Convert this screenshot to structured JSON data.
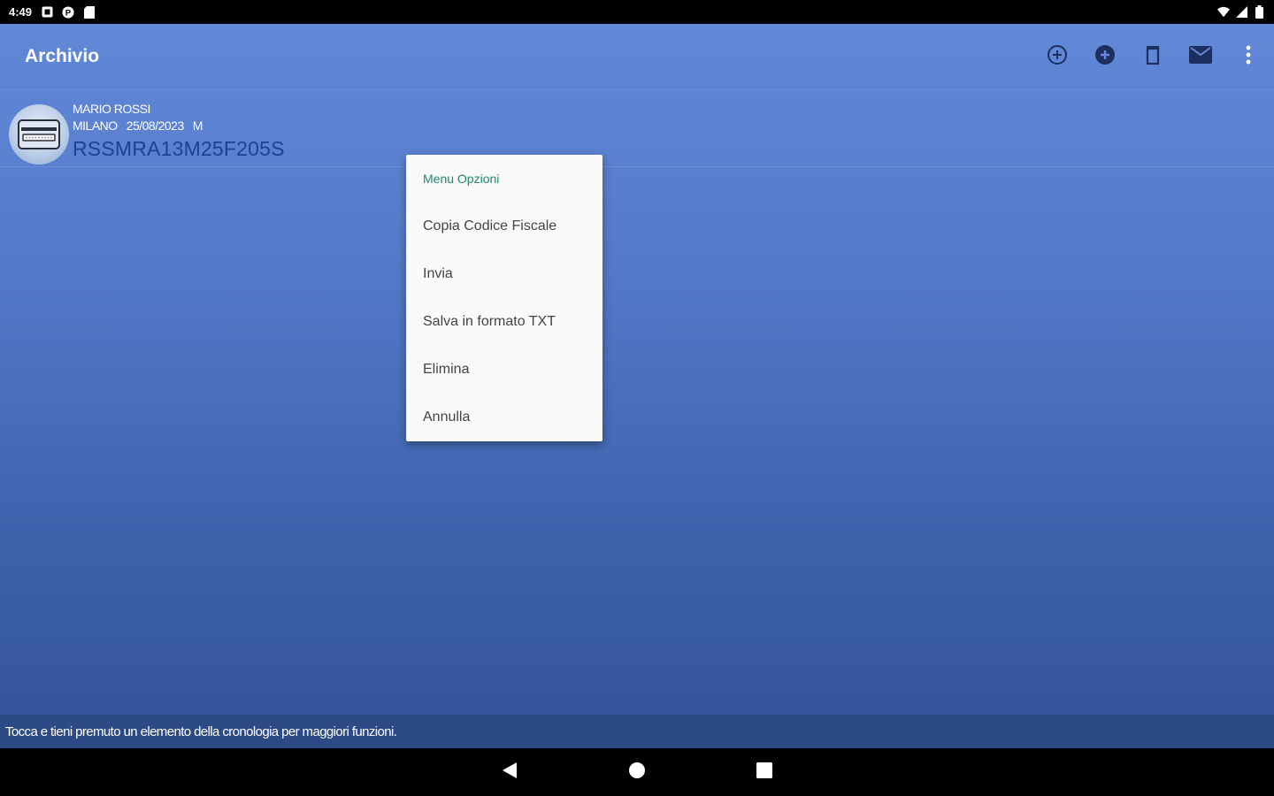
{
  "status_bar": {
    "time": "4:49",
    "left_icons": [
      "notification-square-icon",
      "p-circle-icon",
      "sd-card-icon"
    ],
    "right_icons": [
      "wifi-icon",
      "signal-icon",
      "battery-icon"
    ]
  },
  "toolbar": {
    "title": "Archivio",
    "actions": [
      "add-outline-icon",
      "add-filled-icon",
      "delete-icon",
      "mail-icon",
      "overflow-menu-icon"
    ]
  },
  "history": {
    "items": [
      {
        "name": "MARIO ROSSI",
        "place": "MILANO",
        "date": "25/08/2023",
        "sex": "M",
        "code": "RSSMRA13M25F205S",
        "icon": "id-card-icon"
      }
    ]
  },
  "context_menu": {
    "title": "Menu Opzioni",
    "items": [
      "Copia Codice Fiscale",
      "Invia",
      "Salva in formato TXT",
      "Elimina",
      "Annulla"
    ]
  },
  "hint": {
    "text": "Tocca e tieni premuto un elemento della cronologia per maggiori funzioni."
  },
  "nav_bar": {
    "buttons": [
      "back-icon",
      "home-icon",
      "recents-icon"
    ]
  },
  "colors": {
    "gradient_top": "#6189d8",
    "gradient_bottom": "#32529a",
    "code_text": "#1e3f9a",
    "menu_title": "#1f8a6d",
    "hint_bar": "#2c4a86"
  }
}
